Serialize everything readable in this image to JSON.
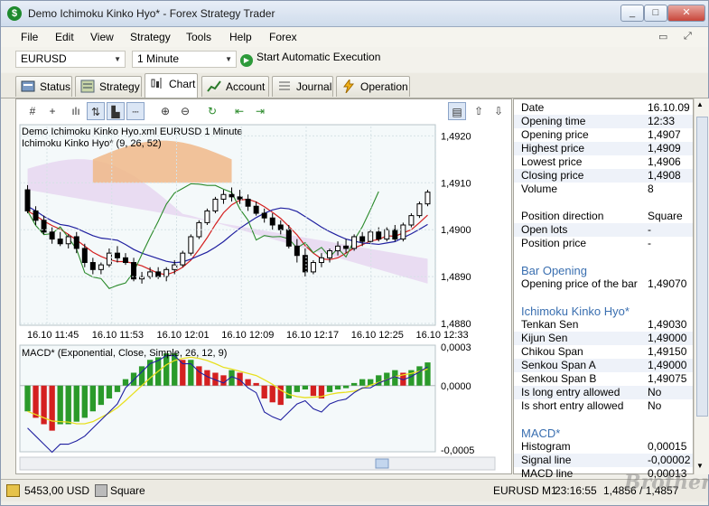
{
  "window": {
    "title": "Demo Ichimoku Kinko Hyo* - Forex Strategy Trader",
    "min": "_",
    "max": "□",
    "close": "✕"
  },
  "menu": [
    "File",
    "Edit",
    "View",
    "Strategy",
    "Tools",
    "Help",
    "Forex"
  ],
  "toolbar": {
    "symbol": "EURUSD",
    "period": "1 Minute",
    "start_label": "Start Automatic Execution"
  },
  "tabs": [
    {
      "label": "Status",
      "icon": "status-icon"
    },
    {
      "label": "Strategy",
      "icon": "strategy-icon"
    },
    {
      "label": "Chart",
      "icon": "chart-icon",
      "active": true
    },
    {
      "label": "Account",
      "icon": "account-icon"
    },
    {
      "label": "Journal",
      "icon": "journal-icon"
    },
    {
      "label": "Operation",
      "icon": "operation-icon"
    }
  ],
  "chart": {
    "caption_line1": "Demo Ichimoku Kinko Hyo.xml EURUSD 1 Minute",
    "caption_line2": "Ichimoku Kinko Hyo* (9, 26, 52)",
    "price_ticks": [
      "1,4920",
      "1,4910",
      "1,4900",
      "1,4890",
      "1,4880"
    ],
    "time_ticks": [
      "16.10 11:45",
      "16.10 11:53",
      "16.10 12:01",
      "16.10 12:09",
      "16.10 12:17",
      "16.10 12:25",
      "16.10 12:33"
    ],
    "macd_caption": "MACD* (Exponential, Close, Simple, 26, 12, 9)",
    "macd_ticks": [
      "0,0003",
      "0,0000",
      "-0,0005"
    ]
  },
  "chart_data": {
    "type": "candlestick",
    "title": "Demo Ichimoku Kinko Hyo.xml EURUSD 1 Minute",
    "ylim": [
      1.488,
      1.4922
    ],
    "candles": [
      {
        "o": 1.49085,
        "h": 1.49095,
        "l": 1.49035,
        "c": 1.4904
      },
      {
        "o": 1.4904,
        "h": 1.4905,
        "l": 1.4901,
        "c": 1.4902
      },
      {
        "o": 1.4902,
        "h": 1.4903,
        "l": 1.4899,
        "c": 1.48995
      },
      {
        "o": 1.48995,
        "h": 1.49005,
        "l": 1.4897,
        "c": 1.4898
      },
      {
        "o": 1.4898,
        "h": 1.48995,
        "l": 1.48965,
        "c": 1.4897
      },
      {
        "o": 1.4897,
        "h": 1.4899,
        "l": 1.4896,
        "c": 1.48985
      },
      {
        "o": 1.48985,
        "h": 1.48995,
        "l": 1.4895,
        "c": 1.4896
      },
      {
        "o": 1.4896,
        "h": 1.4897,
        "l": 1.4892,
        "c": 1.4893
      },
      {
        "o": 1.4893,
        "h": 1.4894,
        "l": 1.48905,
        "c": 1.48915
      },
      {
        "o": 1.48915,
        "h": 1.4893,
        "l": 1.48905,
        "c": 1.48925
      },
      {
        "o": 1.48925,
        "h": 1.4896,
        "l": 1.4892,
        "c": 1.4895
      },
      {
        "o": 1.4895,
        "h": 1.48965,
        "l": 1.4893,
        "c": 1.4894
      },
      {
        "o": 1.4894,
        "h": 1.4895,
        "l": 1.48925,
        "c": 1.4893
      },
      {
        "o": 1.4893,
        "h": 1.4894,
        "l": 1.4889,
        "c": 1.48895
      },
      {
        "o": 1.48895,
        "h": 1.4891,
        "l": 1.48885,
        "c": 1.489
      },
      {
        "o": 1.489,
        "h": 1.4892,
        "l": 1.48895,
        "c": 1.4891
      },
      {
        "o": 1.4891,
        "h": 1.4892,
        "l": 1.48895,
        "c": 1.489
      },
      {
        "o": 1.489,
        "h": 1.4892,
        "l": 1.4889,
        "c": 1.48915
      },
      {
        "o": 1.48915,
        "h": 1.48935,
        "l": 1.48905,
        "c": 1.48925
      },
      {
        "o": 1.48925,
        "h": 1.48955,
        "l": 1.4892,
        "c": 1.4895
      },
      {
        "o": 1.4895,
        "h": 1.4899,
        "l": 1.48945,
        "c": 1.48985
      },
      {
        "o": 1.48985,
        "h": 1.4902,
        "l": 1.4898,
        "c": 1.49015
      },
      {
        "o": 1.49015,
        "h": 1.49045,
        "l": 1.4901,
        "c": 1.4904
      },
      {
        "o": 1.4904,
        "h": 1.4907,
        "l": 1.49035,
        "c": 1.49065
      },
      {
        "o": 1.49065,
        "h": 1.49085,
        "l": 1.49055,
        "c": 1.49075
      },
      {
        "o": 1.49075,
        "h": 1.4909,
        "l": 1.4906,
        "c": 1.4907
      },
      {
        "o": 1.4907,
        "h": 1.49085,
        "l": 1.49055,
        "c": 1.49065
      },
      {
        "o": 1.49065,
        "h": 1.49075,
        "l": 1.4904,
        "c": 1.4905
      },
      {
        "o": 1.4905,
        "h": 1.4906,
        "l": 1.4903,
        "c": 1.49035
      },
      {
        "o": 1.49035,
        "h": 1.49045,
        "l": 1.49015,
        "c": 1.49025
      },
      {
        "o": 1.49025,
        "h": 1.49035,
        "l": 1.49,
        "c": 1.4901
      },
      {
        "o": 1.4901,
        "h": 1.4902,
        "l": 1.4899,
        "c": 1.49
      },
      {
        "o": 1.49,
        "h": 1.4901,
        "l": 1.4896,
        "c": 1.48965
      },
      {
        "o": 1.48965,
        "h": 1.4898,
        "l": 1.4893,
        "c": 1.48945
      },
      {
        "o": 1.48945,
        "h": 1.4896,
        "l": 1.489,
        "c": 1.4891
      },
      {
        "o": 1.4891,
        "h": 1.48935,
        "l": 1.48905,
        "c": 1.4893
      },
      {
        "o": 1.4893,
        "h": 1.4895,
        "l": 1.4892,
        "c": 1.4894
      },
      {
        "o": 1.4894,
        "h": 1.4896,
        "l": 1.4893,
        "c": 1.48955
      },
      {
        "o": 1.48955,
        "h": 1.48975,
        "l": 1.48945,
        "c": 1.48965
      },
      {
        "o": 1.48965,
        "h": 1.4898,
        "l": 1.4895,
        "c": 1.4896
      },
      {
        "o": 1.4896,
        "h": 1.4899,
        "l": 1.48955,
        "c": 1.48985
      },
      {
        "o": 1.48985,
        "h": 1.48995,
        "l": 1.48965,
        "c": 1.48975
      },
      {
        "o": 1.48975,
        "h": 1.49,
        "l": 1.4897,
        "c": 1.48995
      },
      {
        "o": 1.48995,
        "h": 1.49005,
        "l": 1.48975,
        "c": 1.4898
      },
      {
        "o": 1.4898,
        "h": 1.49005,
        "l": 1.48975,
        "c": 1.49
      },
      {
        "o": 1.49,
        "h": 1.4901,
        "l": 1.48975,
        "c": 1.4898
      },
      {
        "o": 1.4898,
        "h": 1.49015,
        "l": 1.48975,
        "c": 1.4901
      },
      {
        "o": 1.4901,
        "h": 1.49035,
        "l": 1.49005,
        "c": 1.4903
      },
      {
        "o": 1.4903,
        "h": 1.4906,
        "l": 1.49025,
        "c": 1.49055
      },
      {
        "o": 1.49055,
        "h": 1.49085,
        "l": 1.4905,
        "c": 1.4908
      }
    ],
    "macd_ylim": [
      -0.0005,
      0.0003
    ],
    "macd_histogram": [
      -0.0002,
      -0.00025,
      -0.0003,
      -0.00035,
      -0.0003,
      -0.0003,
      -0.00028,
      -0.00025,
      -0.0002,
      -0.00015,
      -0.0001,
      -5e-05,
      5e-05,
      0.0001,
      0.00015,
      0.0002,
      0.00022,
      0.00025,
      0.00025,
      0.0002,
      0.0002,
      0.00015,
      0.00012,
      0.0001,
      8e-05,
      0.00012,
      0.0001,
      5e-05,
      2e-05,
      -0.0001,
      -0.00013,
      -0.00015,
      -0.0001,
      -5e-05,
      -3e-05,
      -8e-05,
      -0.0001,
      -5e-05,
      -3e-05,
      -2e-05,
      2e-05,
      5e-05,
      5e-05,
      8e-05,
      0.0001,
      0.00012,
      0.0001,
      0.00012,
      0.00015,
      0.00018
    ]
  },
  "info": {
    "rows1": [
      {
        "k": "Date",
        "v": "16.10.09"
      },
      {
        "k": "Opening time",
        "v": "12:33"
      },
      {
        "k": "Opening price",
        "v": "1,4907"
      },
      {
        "k": "Highest price",
        "v": "1,4909"
      },
      {
        "k": "Lowest price",
        "v": "1,4906"
      },
      {
        "k": "Closing price",
        "v": "1,4908"
      },
      {
        "k": "Volume",
        "v": "8"
      }
    ],
    "rows2": [
      {
        "k": "Position direction",
        "v": "Square"
      },
      {
        "k": "Open lots",
        "v": "-"
      },
      {
        "k": "Position price",
        "v": "-"
      }
    ],
    "bar_opening_head": "Bar Opening",
    "bar_opening_row": {
      "k": "Opening price of the bar",
      "v": "1,49070"
    },
    "ichimoku_head": "Ichimoku Kinko Hyo*",
    "ichimoku_rows": [
      {
        "k": "Tenkan Sen",
        "v": "1,49030"
      },
      {
        "k": "Kijun Sen",
        "v": "1,49000"
      },
      {
        "k": "Chikou Span",
        "v": "1,49150"
      },
      {
        "k": "Senkou Span A",
        "v": "1,49000"
      },
      {
        "k": "Senkou Span B",
        "v": "1,49075"
      },
      {
        "k": "Is long entry allowed",
        "v": "No"
      },
      {
        "k": "Is short entry allowed",
        "v": "No"
      }
    ],
    "macd_head": "MACD*",
    "macd_rows": [
      {
        "k": "Histogram",
        "v": "0,00015"
      },
      {
        "k": "Signal line",
        "v": "-0,00002"
      },
      {
        "k": "MACD line",
        "v": "0,00013"
      }
    ]
  },
  "status": {
    "balance": "5453,00 USD",
    "position": "Square",
    "symbol_period": "EURUSD M1",
    "tick": "23:16:55",
    "prices": "1,4856 / 1,4857"
  },
  "watermark": "Brothersoft"
}
